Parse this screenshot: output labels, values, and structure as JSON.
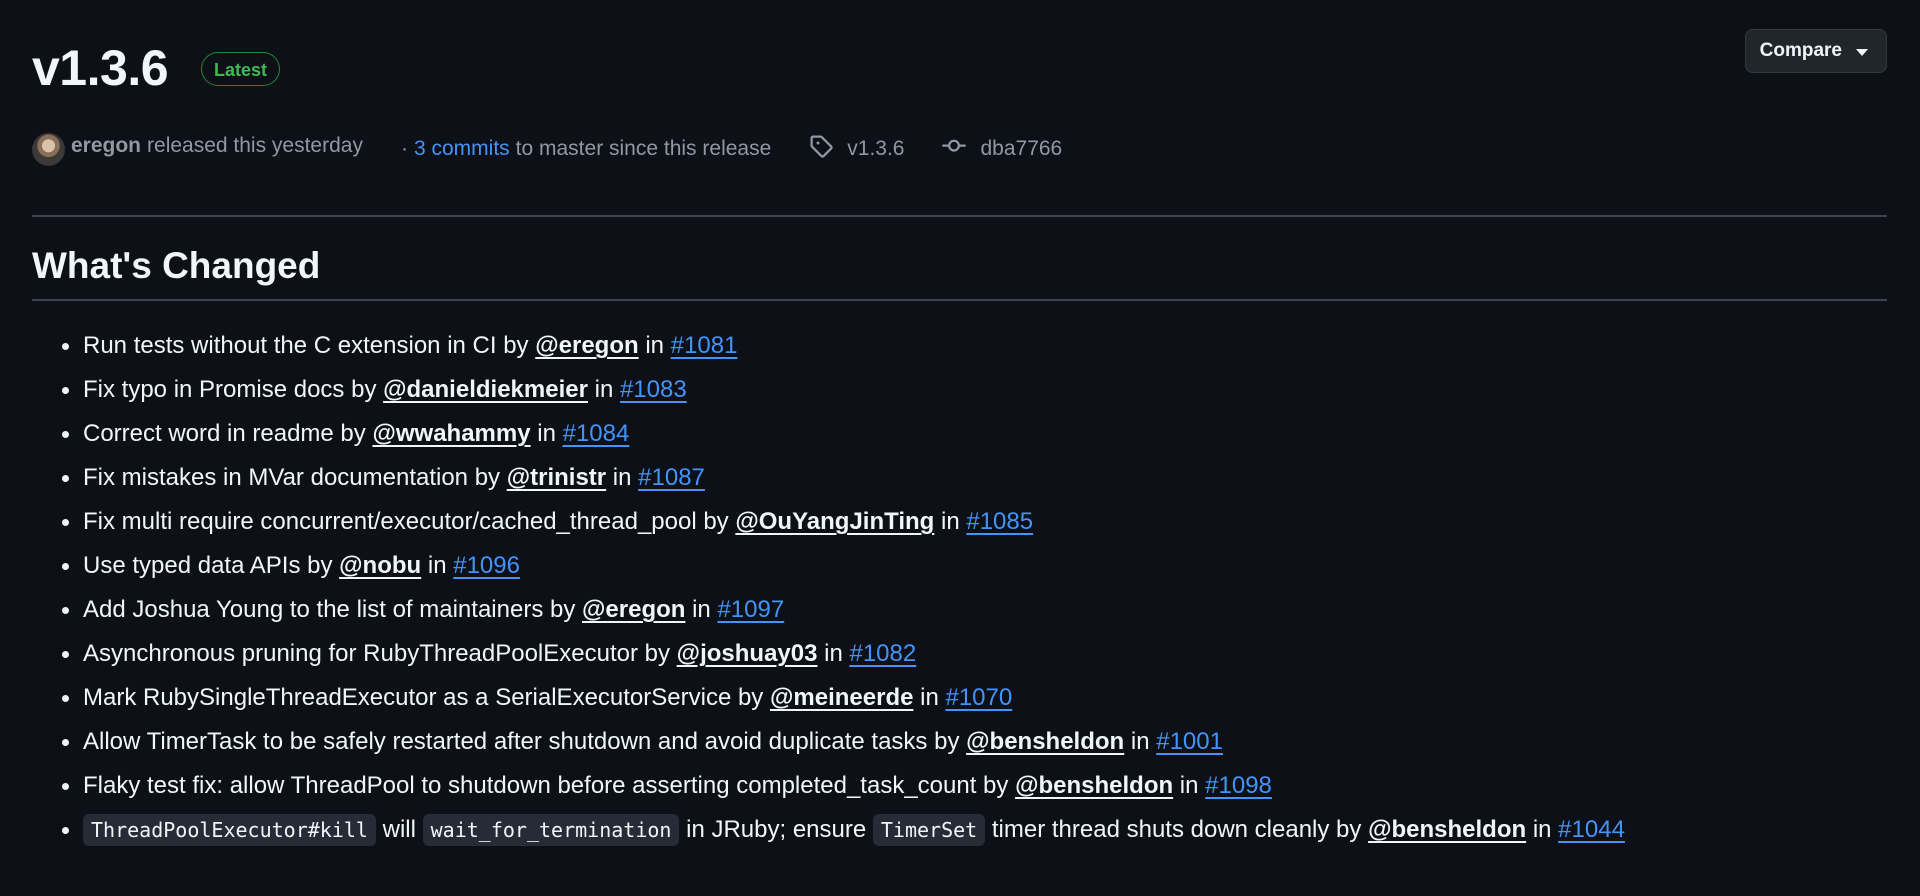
{
  "release": {
    "title": "v1.3.6",
    "badge": "Latest",
    "compare_label": "Compare"
  },
  "meta": {
    "author": "eregon",
    "released_text": "released this yesterday",
    "separator": "·",
    "commits_link": "3 commits",
    "since_text": "to master since this release",
    "tag": "v1.3.6",
    "commit": "dba7766"
  },
  "section": {
    "heading": "What's Changed"
  },
  "changes": [
    {
      "text": "Run tests without the C extension in CI by ",
      "user": "@eregon",
      "in": " in ",
      "pr": "#1081"
    },
    {
      "text": "Fix typo in Promise docs by ",
      "user": "@danieldiekmeier",
      "in": " in ",
      "pr": "#1083"
    },
    {
      "text": "Correct word in readme by ",
      "user": "@wwahammy",
      "in": " in ",
      "pr": "#1084"
    },
    {
      "text": "Fix mistakes in MVar documentation by ",
      "user": "@trinistr",
      "in": " in ",
      "pr": "#1087"
    },
    {
      "text": "Fix multi require concurrent/executor/cached_thread_pool by ",
      "user": "@OuYangJinTing",
      "in": " in ",
      "pr": "#1085"
    },
    {
      "text": "Use typed data APIs by ",
      "user": "@nobu",
      "in": " in ",
      "pr": "#1096"
    },
    {
      "text": "Add Joshua Young to the list of maintainers by ",
      "user": "@eregon",
      "in": " in ",
      "pr": "#1097"
    },
    {
      "text": "Asynchronous pruning for RubyThreadPoolExecutor by ",
      "user": "@joshuay03",
      "in": " in ",
      "pr": "#1082"
    },
    {
      "text": "Mark RubySingleThreadExecutor as a SerialExecutorService by ",
      "user": "@meineerde",
      "in": " in ",
      "pr": "#1070"
    },
    {
      "text": "Allow TimerTask to be safely restarted after shutdown and avoid duplicate tasks by ",
      "user": "@bensheldon",
      "in": " in ",
      "pr": "#1001"
    },
    {
      "text": "Flaky test fix: allow ThreadPool to shutdown before asserting completed_task_count by ",
      "user": "@bensheldon",
      "in": " in ",
      "pr": "#1098"
    }
  ],
  "last_change": {
    "code1": "ThreadPoolExecutor#kill",
    "text1": " will ",
    "code2": "wait_for_termination",
    "text2": " in JRuby; ensure ",
    "code3": "TimerSet",
    "text3": " timer thread shuts down cleanly by ",
    "user": "@bensheldon",
    "in": " in ",
    "pr": "#1044"
  },
  "icons": {
    "tag": "tag-icon",
    "commit": "git-commit-icon",
    "caret": "triangle-down-icon"
  },
  "colors": {
    "background": "#0d1117",
    "link": "#4493f8",
    "badge": "#3fb950",
    "muted": "#9198a1"
  }
}
